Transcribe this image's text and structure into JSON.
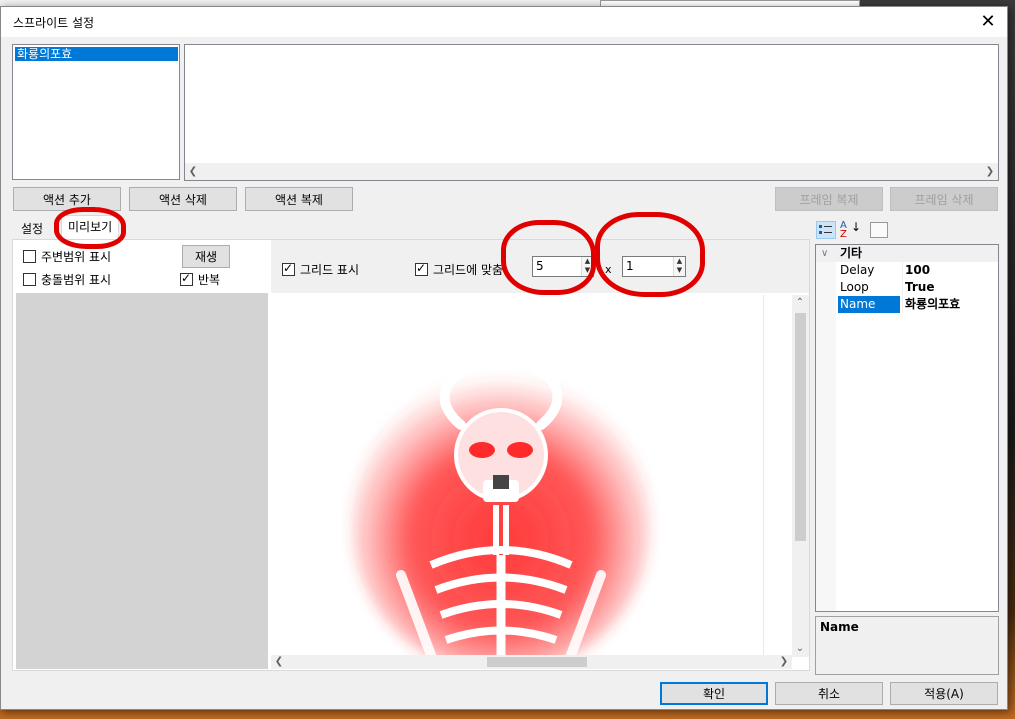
{
  "dialog": {
    "title": "스프라이트 설정",
    "close_glyph": "✕"
  },
  "sprite_list": {
    "items": [
      "화룡의포효"
    ]
  },
  "action_buttons": {
    "add": "액션 추가",
    "delete": "액션 삭제",
    "duplicate": "액션 복제",
    "frame_duplicate": "프레임 복제",
    "frame_delete": "프레임 삭제"
  },
  "tabs": [
    {
      "label": "설정",
      "active": false
    },
    {
      "label": "미리보기",
      "active": true
    }
  ],
  "preview_options": {
    "show_surround": "주변범위 표시",
    "show_collision": "충돌범위 표시",
    "play": "재생",
    "repeat": "반복",
    "repeat_checked": true,
    "show_surround_checked": false,
    "show_collision_checked": false
  },
  "grid": {
    "show_grid": "그리드 표시",
    "show_grid_checked": true,
    "fit_grid": "그리드에 맞춤",
    "fit_grid_checked": true,
    "cols": "5",
    "times": "x",
    "rows": "1"
  },
  "property_grid": {
    "category": "기타",
    "rows": [
      {
        "key": "Delay",
        "value": "100"
      },
      {
        "key": "Loop",
        "value": "True"
      },
      {
        "key": "Name",
        "value": "화룡의포효",
        "selected": true
      }
    ],
    "description_title": "Name"
  },
  "footer": {
    "ok": "확인",
    "cancel": "취소",
    "apply": "적용(A)"
  },
  "colors": {
    "accent": "#0078d7",
    "annotation": "#e00000"
  },
  "icons": {
    "categorized": "categorized-icon",
    "alphabetical": "sort-az-icon",
    "property_pages": "property-pages-icon"
  }
}
